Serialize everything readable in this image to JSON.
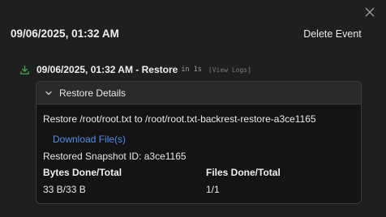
{
  "modal": {
    "title": "09/06/2025, 01:32 AM",
    "delete_label": "Delete Event",
    "close_icon": "close-icon"
  },
  "operation": {
    "icon": "download-icon",
    "icon_color": "#3fa34d",
    "title": "09/06/2025, 01:32 AM - Restore",
    "duration": "in 1s",
    "logs_label": "[View Logs]"
  },
  "details": {
    "header_label": "Restore Details",
    "restore_text": "Restore /root/root.txt to /root/root.txt-backrest-restore-a3ce1165",
    "download_label": "Download File(s)",
    "snapshot_text": "Restored Snapshot ID: a3ce1165",
    "bytes_header": "Bytes Done/Total",
    "bytes_value": "33 B/33 B",
    "files_header": "Files Done/Total",
    "files_value": "1/1"
  },
  "colors": {
    "background": "#1f1f1f",
    "link": "#4f8ff0",
    "success": "#3fa34d"
  }
}
